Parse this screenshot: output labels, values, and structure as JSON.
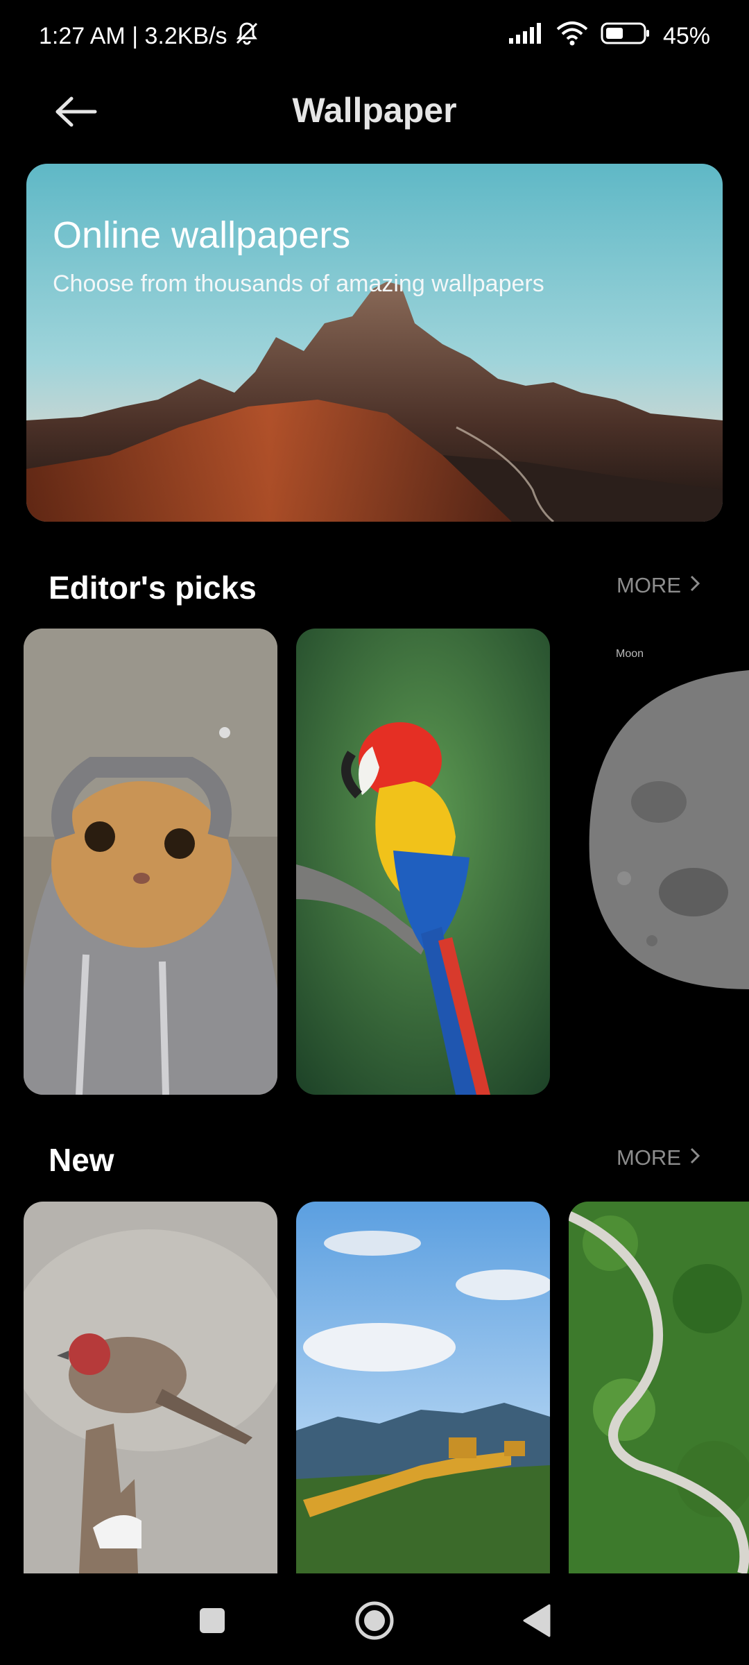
{
  "status_bar": {
    "time_speed": "1:27 AM | 3.2KB/s",
    "battery": "45%",
    "icons": [
      "bell-off-icon",
      "signal-icon",
      "wifi-icon",
      "battery-icon"
    ]
  },
  "header": {
    "title": "Wallpaper",
    "back_icon": "arrow-left-icon"
  },
  "banner": {
    "title": "Online wallpapers",
    "subtitle": "Choose from thousands of amazing wallpapers"
  },
  "sections": {
    "editors_picks": {
      "title": "Editor's picks",
      "more_label": "MORE",
      "cards": [
        {
          "name": "cat-in-hoodie"
        },
        {
          "name": "macaw-parrot"
        },
        {
          "name": "moon",
          "tag": "Moon"
        }
      ]
    },
    "new": {
      "title": "New",
      "more_label": "MORE",
      "cards": [
        {
          "name": "finch-bird"
        },
        {
          "name": "great-wall"
        },
        {
          "name": "winding-road-forest"
        }
      ]
    }
  },
  "nav_bar": {
    "icons": [
      "square-recents-icon",
      "circle-home-icon",
      "triangle-back-icon"
    ]
  },
  "colors": {
    "background": "#000000",
    "title_text": "#e6e6e6",
    "muted_text": "#8d8d8d"
  }
}
